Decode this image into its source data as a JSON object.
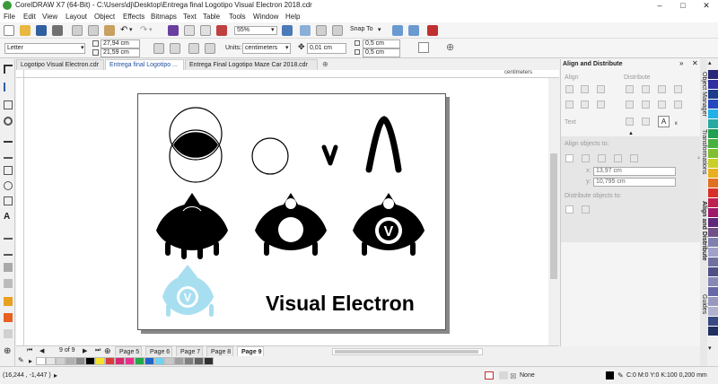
{
  "title": "CorelDRAW X7 (64-Bit) - C:\\Users\\dj\\Desktop\\Entrega final Logotipo Visual Electron 2018.cdr",
  "window_buttons": [
    "–",
    "□",
    "✕"
  ],
  "menu": [
    "File",
    "Edit",
    "View",
    "Layout",
    "Object",
    "Effects",
    "Bitmaps",
    "Text",
    "Table",
    "Tools",
    "Window",
    "Help"
  ],
  "toolbar": {
    "zoom": "55%",
    "snap": "Snap To"
  },
  "propbar": {
    "paper": "Letter",
    "width": "27,94 cm",
    "height": "21,59 cm",
    "units_label": "Units:",
    "units": "centimeters",
    "nudge": "0,01 cm",
    "dup_x": "0,5 cm",
    "dup_y": "0,5 cm"
  },
  "tabs": [
    {
      "label": "Logotipo Visual Electron.cdr",
      "active": false
    },
    {
      "label": "Entrega final Logotipo ...",
      "active": true
    },
    {
      "label": "Entrega Final Logotipo Maze Car 2018.cdr",
      "active": false
    }
  ],
  "ruler_unit": "centimeters",
  "artwork": {
    "wordmark": "Visual Electron",
    "v_letter": "V",
    "accent": "#a8dff0"
  },
  "page_nav": {
    "current": "9 of 9",
    "pages": [
      "Page 5",
      "Page 6",
      "Page 7",
      "Page 8",
      "Page 9"
    ],
    "active": "Page 9"
  },
  "status": {
    "coords": "(16,244 , -1,447 )",
    "fill": "None",
    "outline": "C:0 M:0 Y:0 K:100  0,200 mm"
  },
  "docker": {
    "title": "Align and Distribute",
    "align": "Align",
    "distribute": "Distribute",
    "text": "Text",
    "align_to": "Align objects to:",
    "x": "13,97 cm",
    "y": "10,795 cm",
    "distribute_to": "Distribute objects to:"
  },
  "side_tabs": [
    "Object Manager",
    "Transformations",
    "Align and Distribute",
    "Guides"
  ],
  "palette_bottom": [
    "#ffffff",
    "#e8e8e8",
    "#cfcfcf",
    "#b0b0b0",
    "#8c8c8c",
    "#000000",
    "#f4e22a",
    "#d83b3b",
    "#d8286e",
    "#e8308c",
    "#24a848",
    "#1e64c8",
    "#6fd2f0",
    "#c8c8c8",
    "#a0a0a0",
    "#808080",
    "#606060",
    "#303030"
  ],
  "palette_right": [
    "#282878",
    "#3030a0",
    "#1c3c8c",
    "#2448c0",
    "#22b0e8",
    "#28a8a0",
    "#20a050",
    "#48b040",
    "#80c030",
    "#c8d028",
    "#e8b020",
    "#e07020",
    "#d83028",
    "#c02050",
    "#a01868",
    "#602878",
    "#705088",
    "#8080b0",
    "#a0a0c8",
    "#7070a0",
    "#505088",
    "#8888b8",
    "#6868a8",
    "#9898c0",
    "#b0b0d0",
    "#384880",
    "#203060"
  ]
}
